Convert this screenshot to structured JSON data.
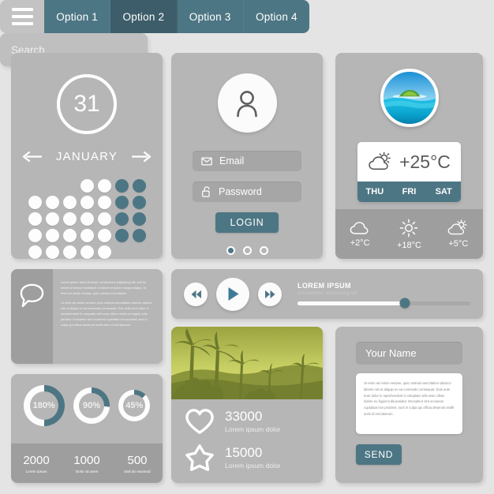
{
  "theme": {
    "background": "#e4e4e4",
    "card": "#b6b6b6",
    "card_dark": "#9e9e9e",
    "accent": "#4d7684",
    "accent_active": "#3c5d69",
    "white": "#ffffff"
  },
  "navbar": {
    "menu_icon": "hamburger-icon",
    "options": [
      {
        "label": "Option 1",
        "active": false
      },
      {
        "label": "Option 2",
        "active": true
      },
      {
        "label": "Option 3",
        "active": false
      },
      {
        "label": "Option 4",
        "active": false
      }
    ]
  },
  "search": {
    "placeholder": "Search_",
    "value": "",
    "icon": "search-icon"
  },
  "calendar": {
    "day": "31",
    "month": "JANUARY",
    "prev_icon": "arrow-left-icon",
    "next_icon": "arrow-right-icon",
    "grid": [
      [
        "e",
        "e",
        "e",
        "w",
        "w",
        "t",
        "t"
      ],
      [
        "w",
        "w",
        "w",
        "w",
        "w",
        "t",
        "t"
      ],
      [
        "w",
        "w",
        "w",
        "w",
        "w",
        "t",
        "t"
      ],
      [
        "w",
        "w",
        "w",
        "w",
        "w",
        "t",
        "t"
      ],
      [
        "w",
        "w",
        "w",
        "w",
        "w",
        "e",
        "e"
      ]
    ]
  },
  "login": {
    "avatar_icon": "user-icon",
    "email": {
      "label": "Email",
      "icon": "envelope-icon"
    },
    "password": {
      "label": "Password",
      "icon": "unlock-icon"
    },
    "button": "LOGIN",
    "pager": [
      true,
      false,
      false
    ]
  },
  "weather": {
    "avatar_icon": "island-photo",
    "current_temp": "+25°C",
    "current_icon": "sun-cloud-icon",
    "days": [
      "THU",
      "FRI",
      "SAT"
    ],
    "forecast": [
      {
        "icon": "cloud-icon",
        "temp": "+2°C"
      },
      {
        "icon": "sun-icon",
        "temp": "+18°C"
      },
      {
        "icon": "sun-cloud-icon",
        "temp": "+5°C"
      }
    ]
  },
  "comment": {
    "icon": "speech-bubble-icon",
    "paragraphs": [
      "Lorem ipsum dolor sit amet, consectetur adipisicing elit, sed do eiusmod tempor incididunt ut labore et dolore magna aliqua. Ut enim ad minim veniam, quis nostrud exercitation.",
      "Ut enim ad minim veniam, quis nostrud exercitation ullamco laboris nisi ut aliquip ex ea commodo consequat. Duis aute irure dolor in reprehenderit in voluptate velit esse cillum dolore eu fugiat nulla pariatur. Excepteur sint occaecat cupidatat non proident, sunt in culpa qui officia deserunt mollit anim id est laborum."
    ]
  },
  "player": {
    "prev_icon": "rewind-icon",
    "play_icon": "play-icon",
    "next_icon": "fast-forward-icon",
    "title": "LOREM IPSUM",
    "subtitle": "consectetur adipisicing elit",
    "progress_percent": 62
  },
  "stats": {
    "donuts": [
      {
        "label": "180%",
        "percent": 50,
        "size": 52
      },
      {
        "label": "90%",
        "percent": 26,
        "size": 46
      },
      {
        "label": "45%",
        "percent": 13,
        "size": 40
      }
    ],
    "footer": [
      {
        "value": "2000",
        "label": "Lorem Ipsum"
      },
      {
        "value": "1000",
        "label": "Dolor sit amet"
      },
      {
        "value": "500",
        "label": "Sed do eiusmod"
      }
    ]
  },
  "photo": {
    "image_alt": "palm-tree-silhouette",
    "stats": [
      {
        "icon": "heart-icon",
        "value": "33000",
        "label": "Lorem ipsum dolor"
      },
      {
        "icon": "star-icon",
        "value": "15000",
        "label": "Lorem ipsum dolor"
      }
    ]
  },
  "contact": {
    "name_placeholder": "Your Name",
    "name_value": "",
    "message": "Ut enim ad minim veniam, quis nostrud exercitation ullamco laboris nisi ut aliquip ex ea commodo consequat. Duis aute irure dolor in reprehenderit in voluptate velit esse cillum dolore eu fugiat nulla pariatur. Excepteur sint occaecat cupidatat non proident, sunt in culpa qui officia deserunt mollit anim id est laborum.",
    "send_label": "SEND"
  }
}
